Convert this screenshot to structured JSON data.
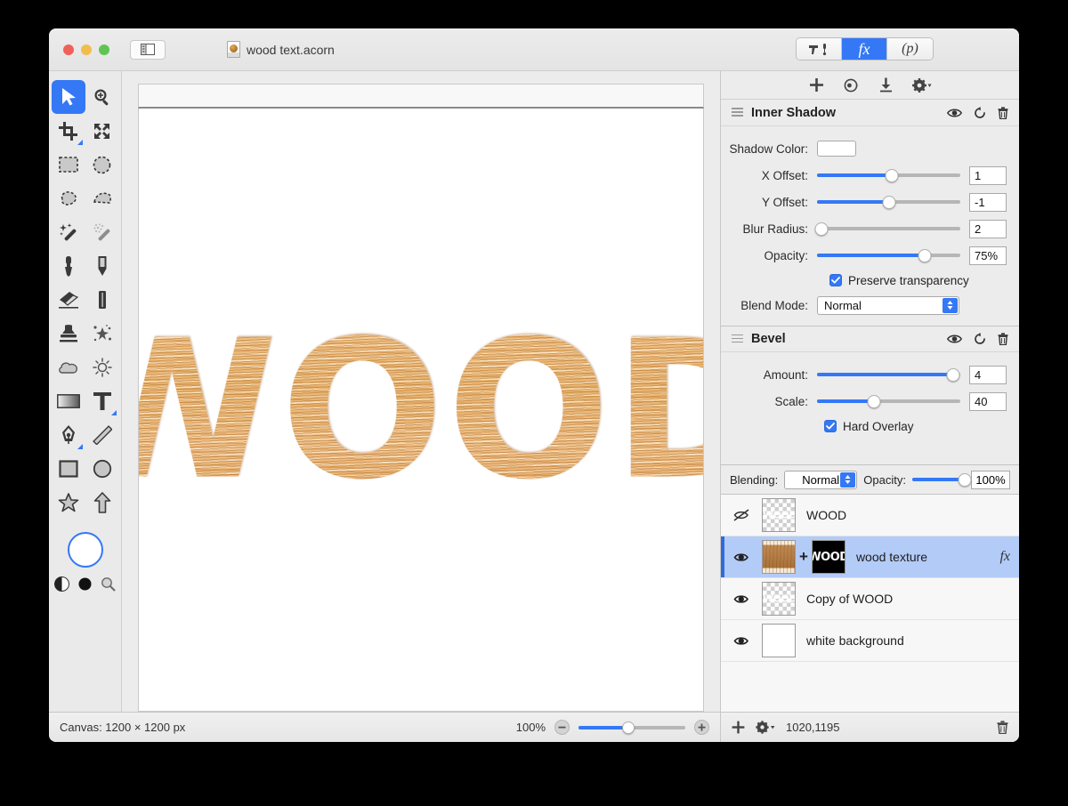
{
  "window": {
    "document_title": "wood text.acorn",
    "traffic_lights": [
      "close",
      "minimize",
      "zoom"
    ],
    "sidebar_toggle_icon": "sidebar-toggle-icon"
  },
  "mode_tabs": [
    {
      "id": "tools",
      "label": "",
      "icon": "hammer-dropper-icon",
      "active": false
    },
    {
      "id": "effects",
      "label": "fx",
      "icon": "fx-icon",
      "active": true
    },
    {
      "id": "presets",
      "label": "(p)",
      "icon": "palette-icon",
      "active": false
    }
  ],
  "tool_palette": {
    "tools": [
      {
        "name": "move-tool",
        "icon": "cursor-arrow-icon",
        "active": true,
        "submenu": false
      },
      {
        "name": "zoom-tool",
        "icon": "magnifier-plus-icon",
        "active": false,
        "submenu": false
      },
      {
        "name": "crop-tool",
        "icon": "crop-icon",
        "active": false,
        "submenu": true
      },
      {
        "name": "transform-tool",
        "icon": "move-arrows-icon",
        "active": false,
        "submenu": false
      },
      {
        "name": "rectangular-select-tool",
        "icon": "dashed-rectangle-icon",
        "active": false,
        "submenu": false
      },
      {
        "name": "elliptical-select-tool",
        "icon": "dashed-circle-icon",
        "active": false,
        "submenu": false
      },
      {
        "name": "lasso-tool",
        "icon": "lasso-icon",
        "active": false,
        "submenu": false
      },
      {
        "name": "polygon-select-tool",
        "icon": "polygon-lasso-icon",
        "active": false,
        "submenu": false
      },
      {
        "name": "magic-wand-tool",
        "icon": "magic-wand-icon",
        "active": false,
        "submenu": false
      },
      {
        "name": "instant-alpha-tool",
        "icon": "sparkle-wand-icon",
        "active": false,
        "submenu": false
      },
      {
        "name": "paint-brush-tool",
        "icon": "brush-icon",
        "active": false,
        "submenu": false
      },
      {
        "name": "pencil-tool",
        "icon": "pencil-icon",
        "active": false,
        "submenu": false
      },
      {
        "name": "eraser-tool",
        "icon": "eraser-icon",
        "active": false,
        "submenu": false
      },
      {
        "name": "smudge-tool",
        "icon": "smudge-icon",
        "active": false,
        "submenu": false
      },
      {
        "name": "clone-stamp-tool",
        "icon": "stamp-icon",
        "active": false,
        "submenu": false
      },
      {
        "name": "spatter-tool",
        "icon": "spatter-icon",
        "active": false,
        "submenu": false
      },
      {
        "name": "blur-tool",
        "icon": "cloud-icon",
        "active": false,
        "submenu": false
      },
      {
        "name": "dodge-burn-tool",
        "icon": "sun-icon",
        "active": false,
        "submenu": false
      },
      {
        "name": "gradient-tool",
        "icon": "gradient-icon",
        "active": false,
        "submenu": false
      },
      {
        "name": "text-tool",
        "icon": "text-T-icon",
        "active": false,
        "submenu": true
      },
      {
        "name": "bezier-pen-tool",
        "icon": "pen-nib-icon",
        "active": false,
        "submenu": true
      },
      {
        "name": "line-tool",
        "icon": "line-icon",
        "active": false,
        "submenu": false
      },
      {
        "name": "rectangle-shape-tool",
        "icon": "rectangle-icon",
        "active": false,
        "submenu": false
      },
      {
        "name": "ellipse-shape-tool",
        "icon": "circle-icon",
        "active": false,
        "submenu": false
      },
      {
        "name": "star-shape-tool",
        "icon": "star-icon",
        "active": false,
        "submenu": false
      },
      {
        "name": "arrow-shape-tool",
        "icon": "arrow-up-icon",
        "active": false,
        "submenu": false
      }
    ],
    "color_swatch": "#ffffff",
    "footer_icons": [
      "half-circle-contrast-icon",
      "black-circle-icon",
      "magnifier-icon"
    ]
  },
  "effects_toolbar": {
    "icons": [
      "add-effect-icon",
      "preset-effect-icon",
      "download-effect-icon",
      "effect-settings-gear-icon"
    ]
  },
  "effects": [
    {
      "title": "Inner Shadow",
      "head_icons": [
        "visibility-eye-icon",
        "reset-icon",
        "delete-trash-icon"
      ],
      "rows": [
        {
          "type": "color",
          "label": "Shadow Color:",
          "value": "#ffffff"
        },
        {
          "type": "slider",
          "label": "X Offset:",
          "value": "1",
          "fill_pct": 52
        },
        {
          "type": "slider",
          "label": "Y Offset:",
          "value": "-1",
          "fill_pct": 50
        },
        {
          "type": "slider",
          "label": "Blur Radius:",
          "value": "2",
          "fill_pct": 3
        },
        {
          "type": "slider",
          "label": "Opacity:",
          "value": "75%",
          "fill_pct": 75
        }
      ],
      "checkbox": {
        "label": "Preserve transparency",
        "checked": true
      },
      "select": {
        "label": "Blend Mode:",
        "value": "Normal"
      }
    },
    {
      "title": "Bevel",
      "head_icons": [
        "visibility-eye-icon",
        "reset-icon",
        "delete-trash-icon"
      ],
      "rows": [
        {
          "type": "slider",
          "label": "Amount:",
          "value": "4",
          "fill_pct": 95
        },
        {
          "type": "slider",
          "label": "Scale:",
          "value": "40",
          "fill_pct": 40
        }
      ],
      "checkbox": {
        "label": "Hard Overlay",
        "checked": true
      }
    }
  ],
  "blending_bar": {
    "blending_label": "Blending:",
    "blending_value": "Normal",
    "opacity_label": "Opacity:",
    "opacity_value": "100%",
    "opacity_fill_pct": 100
  },
  "layers": [
    {
      "name": "WOOD",
      "visible": false,
      "selected": false,
      "thumb": "checker-ghost",
      "ghost_text": "WOOD",
      "has_mask": false,
      "fx": false
    },
    {
      "name": "wood texture",
      "visible": true,
      "selected": true,
      "thumb": "wood",
      "ghost_text": "",
      "has_mask": true,
      "mask_text": "WOOD",
      "fx": true,
      "fx_label": "fx"
    },
    {
      "name": "Copy of WOOD",
      "visible": true,
      "selected": false,
      "thumb": "checker-ghost",
      "ghost_text": "WOOD",
      "has_mask": false,
      "fx": false
    },
    {
      "name": "white background",
      "visible": true,
      "selected": false,
      "thumb": "white",
      "ghost_text": "",
      "has_mask": false,
      "fx": false
    }
  ],
  "status_bar": {
    "canvas_info": "Canvas: 1200 × 1200 px",
    "zoom_percent": "100%",
    "zoom_fill_pct": 47,
    "zoom_out_icon": "minus-circle-icon",
    "zoom_in_icon": "plus-circle-icon"
  },
  "layers_status_bar": {
    "add_layer_icon": "plus-icon",
    "layer_settings_icon": "gear-dropdown-icon",
    "coordinates": "1020,1195",
    "delete_icon": "trash-icon"
  },
  "canvas": {
    "artwork_text": "WOOD"
  },
  "colors": {
    "accent": "#3478f6",
    "selected_row": "#b3cbf7",
    "panel_bg": "#ececec",
    "layers_bg": "#f7f7f7"
  }
}
